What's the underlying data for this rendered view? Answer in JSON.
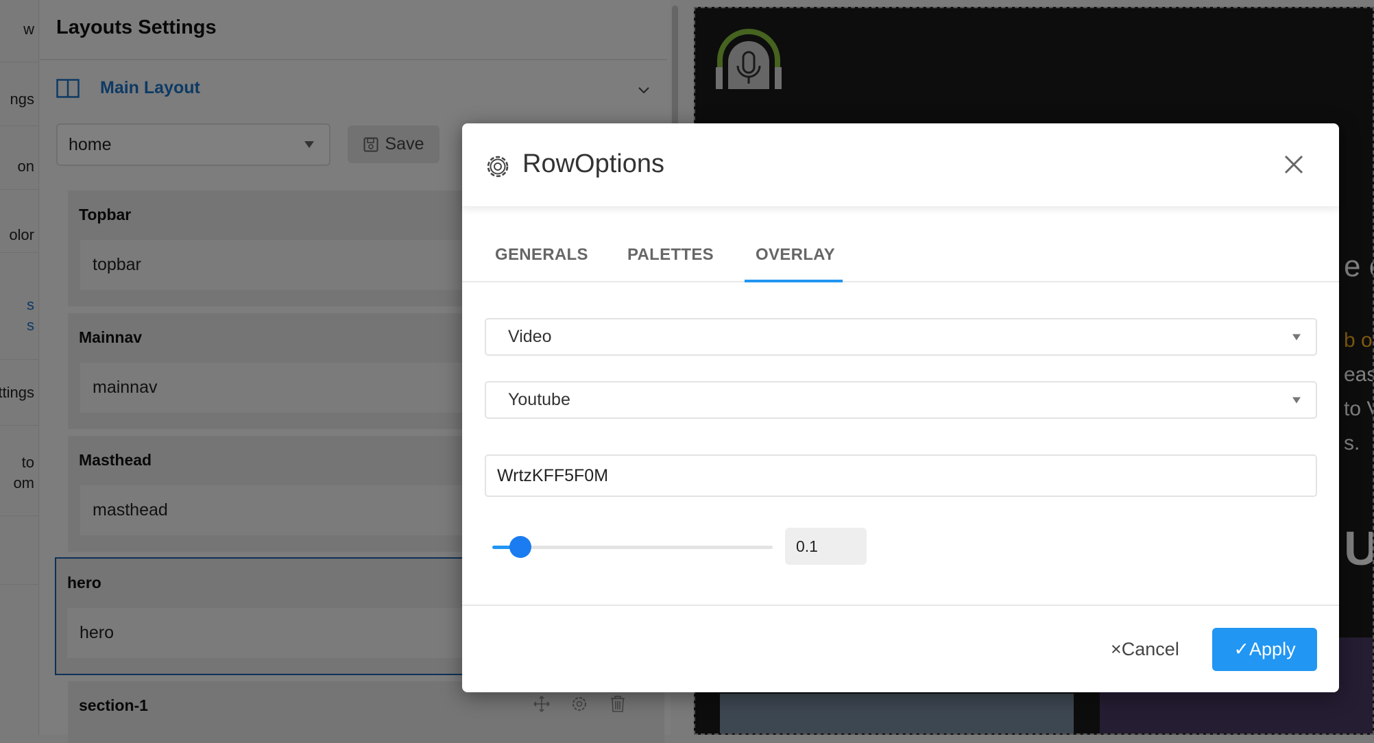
{
  "left_nav": {
    "items": [
      {
        "label": "w"
      },
      {
        "label": "ngs"
      },
      {
        "label": "on"
      },
      {
        "label": "olor"
      },
      {
        "label": "s\ns"
      },
      {
        "label": "ttings"
      },
      {
        "label": "to\nom"
      }
    ]
  },
  "panel": {
    "title": "Layouts Settings",
    "layout_name": "Main Layout",
    "layout_select": "home",
    "save_label": "Save",
    "blocks": [
      {
        "label": "Topbar",
        "value": "topbar"
      },
      {
        "label": "Mainnav",
        "value": "mainnav"
      },
      {
        "label": "Masthead",
        "value": "masthead"
      },
      {
        "label": "hero",
        "value": "hero"
      },
      {
        "label": "section-1",
        "value": ""
      }
    ]
  },
  "preview": {
    "snippets": [
      "e c",
      "b o",
      "eas",
      "to V",
      "s.",
      "UL"
    ]
  },
  "modal": {
    "title": "RowOptions",
    "tabs": [
      {
        "label": "GENERALS",
        "active": false
      },
      {
        "label": "PALETTES",
        "active": false
      },
      {
        "label": "OVERLAY",
        "active": true
      }
    ],
    "overlay_type": "Video",
    "video_source": "Youtube",
    "video_id": "WrtzKFF5F0M",
    "opacity": 0.1,
    "opacity_display": "0.1",
    "cancel_label": "Cancel",
    "apply_label": "Apply"
  },
  "colors": {
    "accent": "#2196f3",
    "link": "#1a73c8",
    "logo_green": "#8dc63f"
  }
}
